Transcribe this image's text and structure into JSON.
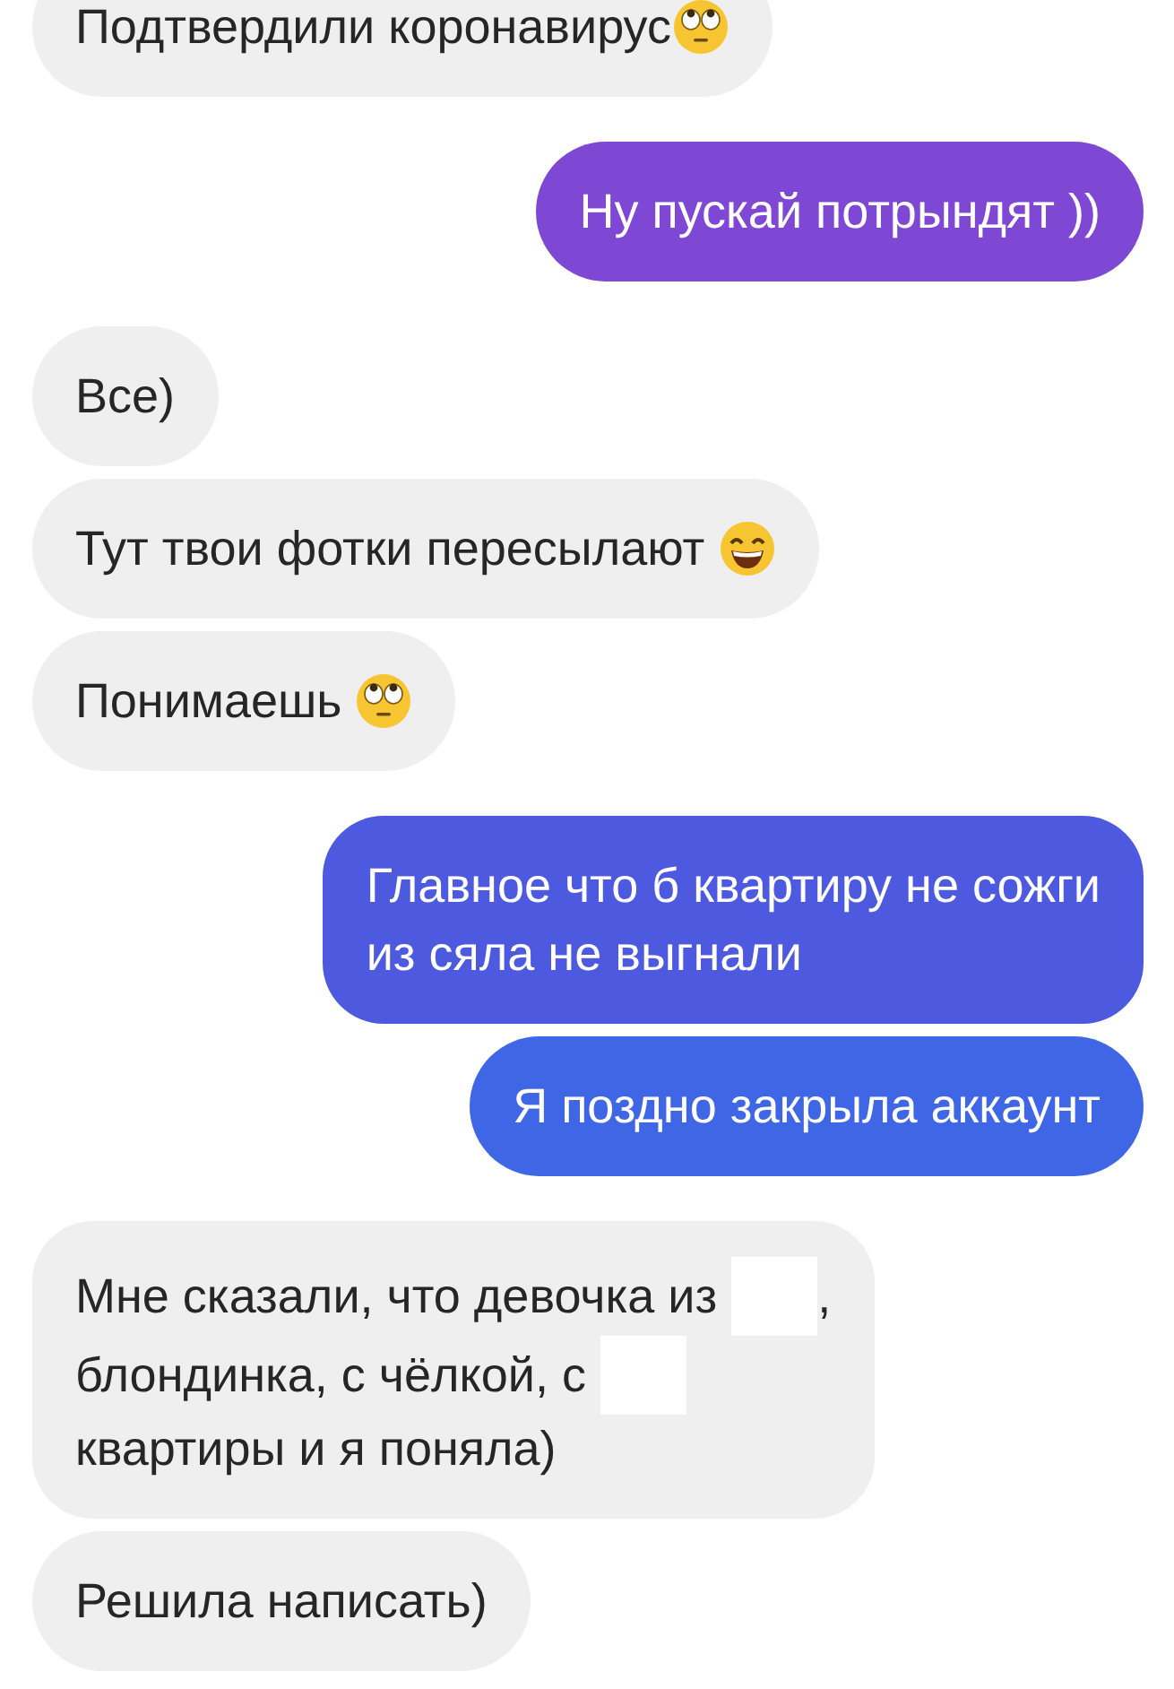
{
  "messages": [
    {
      "kind": "received",
      "text": "Подтвердили коронавирус",
      "emoji": {
        "kind": "rolling-eyes"
      }
    },
    {
      "kind": "sent",
      "text": "Ну пускай потрындят ))",
      "color": "#7e48d5"
    },
    {
      "kind": "received",
      "text": "Все)"
    },
    {
      "kind": "received",
      "text": "Тут твои фотки пересылают ",
      "emoji": {
        "kind": "grin"
      }
    },
    {
      "kind": "received",
      "text": "Понимаешь ",
      "emoji": {
        "kind": "rolling-eyes"
      }
    },
    {
      "kind": "sent",
      "text": "Главное что б квартиру не сожги\nиз сяла не выгнали",
      "color": "#4d5adf"
    },
    {
      "kind": "sent",
      "text": "Я поздно закрыла аккаунт",
      "color": "#3f66e4"
    },
    {
      "kind": "received",
      "lines": [
        [
          {
            "kind": "text",
            "text": "Мне сказали, что девочка из"
          },
          {
            "kind": "redacted"
          },
          {
            "kind": "text",
            "text": ","
          }
        ],
        [
          {
            "kind": "text",
            "text": "блондинка, с чёлкой, с"
          },
          {
            "kind": "redacted"
          }
        ],
        [
          {
            "kind": "text",
            "text": "квартиры и я поняла)"
          }
        ]
      ]
    },
    {
      "kind": "received",
      "text": "Решила написать)"
    }
  ]
}
